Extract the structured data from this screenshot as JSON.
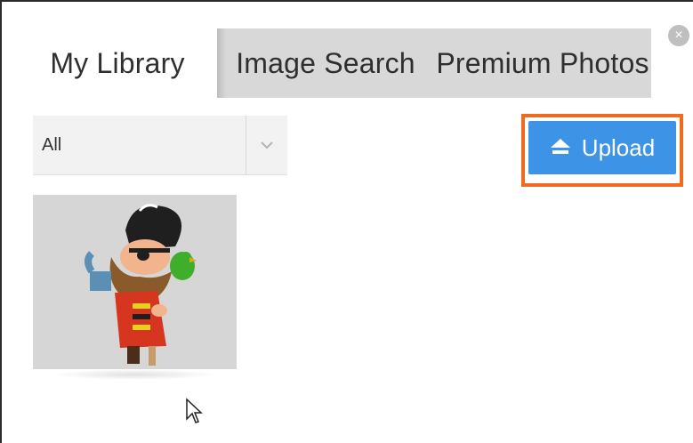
{
  "tabs": [
    {
      "label": "My Library",
      "active": true
    },
    {
      "label": "Image Search",
      "active": false
    },
    {
      "label": "Premium Photos",
      "active": false
    }
  ],
  "filter": {
    "selected": "All",
    "arrow_icon": "chevron-down-icon"
  },
  "upload": {
    "label": "Upload",
    "icon": "upload-arrow-icon",
    "color": "#3d94e6",
    "highlight_color": "#f06a1f"
  },
  "close": {
    "icon": "close-icon",
    "glyph": "×"
  },
  "library_items": [
    {
      "subject": "pirate-with-parrot-cartoon"
    }
  ]
}
